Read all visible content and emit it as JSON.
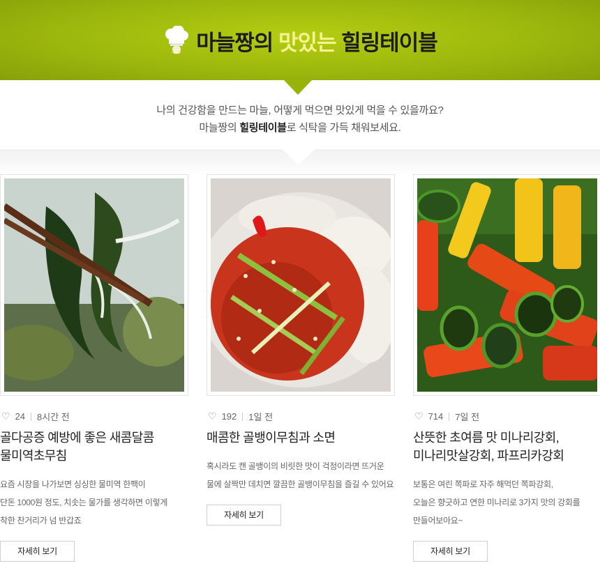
{
  "header": {
    "title_part1": "마늘짱의",
    "title_highlight": "맛있는",
    "title_part2": "힐링테이블",
    "accent_color": "#9db80d"
  },
  "intro": {
    "line1": "나의 건강함을 만드는 마늘, 어떻게 먹으면 맛있게 먹을 수 있을까요?",
    "line2_prefix": "마늘짱의 ",
    "line2_bold": "힐링테이블",
    "line2_suffix": "로 식탁을 가득 채워보세요."
  },
  "cards": [
    {
      "likes": "24",
      "time": "8시간 전",
      "title_line1": "골다공증 예방에 좋은 새콤달콤",
      "title_line2": "물미역초무침",
      "desc_line1": "요즘 시장을 나가보면 싱싱한 물미역 한팩이",
      "desc_line2": "단돈 1000원 정도, 치솟는 물가를 생각하면 이렇게",
      "desc_line3": "착한 찬거리가 넘 반갑죠",
      "button": "자세히 보기",
      "image_icon": "seaweed-salad-photo"
    },
    {
      "likes": "192",
      "time": "1일 전",
      "title_line1": "매콤한 골뱅이무침과 소면",
      "title_line2": "",
      "desc_line1": "혹시라도 캔 골뱅이의 비릿한 맛이 걱정이라면 뜨거운",
      "desc_line2": "물에 살짝만 데치면 깔끔한 골뱅이무침을 즐길 수 있어요",
      "desc_line3": "",
      "button": "자세히 보기",
      "image_icon": "spicy-sea-snail-photo"
    },
    {
      "likes": "714",
      "time": "7일 전",
      "title_line1": "산뜻한 초여름 맛 미나리강회,",
      "title_line2": "미나리맛살강회, 파프리카강회",
      "desc_line1": "보통은 여린 쪽파로 자주 해먹던 쪽파강회,",
      "desc_line2": "오늘은 향긋하고 연한 미나리로 3가지 맛의 강회를",
      "desc_line3": "만들어보아요~",
      "button": "자세히 보기",
      "image_icon": "paprika-rolls-photo"
    }
  ]
}
